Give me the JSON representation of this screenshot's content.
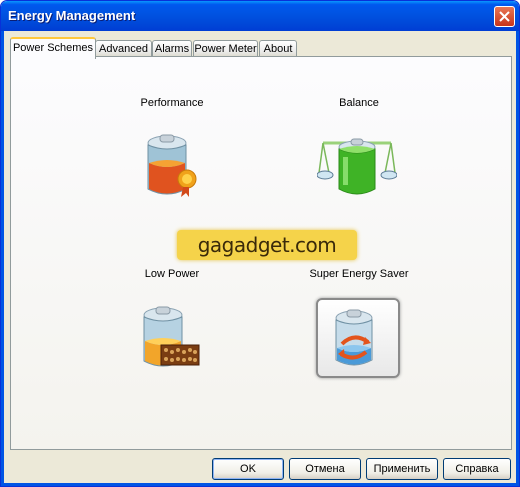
{
  "window": {
    "title": "Energy Management"
  },
  "tabs": [
    {
      "label": "Power Schemes",
      "active": true
    },
    {
      "label": "Advanced",
      "active": false
    },
    {
      "label": "Alarms",
      "active": false
    },
    {
      "label": "Power Meter",
      "active": false
    },
    {
      "label": "About",
      "active": false
    }
  ],
  "schemes": [
    {
      "label": "Performance",
      "icon": "battery-performance-icon",
      "selected": false
    },
    {
      "label": "Balance",
      "icon": "battery-balance-icon",
      "selected": false
    },
    {
      "label": "Low Power",
      "icon": "battery-low-power-icon",
      "selected": false
    },
    {
      "label": "Super Energy Saver",
      "icon": "battery-super-saver-icon",
      "selected": true
    }
  ],
  "watermark": {
    "text": "gagadget.com"
  },
  "buttons": {
    "ok": "OK",
    "cancel": "Отмена",
    "apply": "Применить",
    "help": "Справка"
  },
  "colors": {
    "titlebar": "#0054e3",
    "active_tab_highlight": "#ffc83c",
    "watermark_bg": "#f5d34a"
  }
}
